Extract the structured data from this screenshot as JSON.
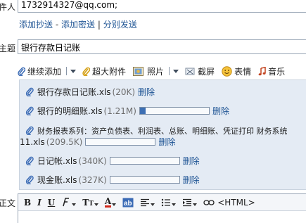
{
  "recipient": {
    "label": "件人",
    "value": "1732914327@qq.com;"
  },
  "cc_links": {
    "add_cc": "添加抄送",
    "dash": "-",
    "add_bcc": "添加密送",
    "pipe": "|",
    "separate_send": "分别发送"
  },
  "subject": {
    "label": "主题",
    "value": "银行存款日记账"
  },
  "toolbar": {
    "continue_add": "继续添加",
    "large_attachment": "超大附件",
    "photo": "照片",
    "screenshot": "截屏",
    "emoji": "表情",
    "music": "音乐"
  },
  "attachments": [
    {
      "name": "银行存款日记账.xls",
      "size": "(20K)",
      "delete": "删除",
      "progress": null
    },
    {
      "name": "银行的明细账.xls",
      "size": "(1.21M)",
      "delete": "删除",
      "progress": 0.08
    },
    {
      "name_line1": "财务报表系列：资产负债表、利润表、总账、明细账、凭证打印 财务系统",
      "name_line2": "11.xls",
      "size": "(209.5K)",
      "delete": "删除",
      "progress": 0.0
    },
    {
      "name": "日记帐.xls",
      "size": "(340K)",
      "delete": "删除",
      "progress": 0.0
    },
    {
      "name": "现金账.xls",
      "size": "(327K)",
      "delete": "删除",
      "progress": 0.0
    }
  ],
  "body": {
    "label": "正文",
    "html_toggle": "<HTML>"
  },
  "colors": {
    "link": "#1e5494",
    "panel_bg": "#e4ebf4",
    "progress_fill": "#3d6fb3"
  }
}
